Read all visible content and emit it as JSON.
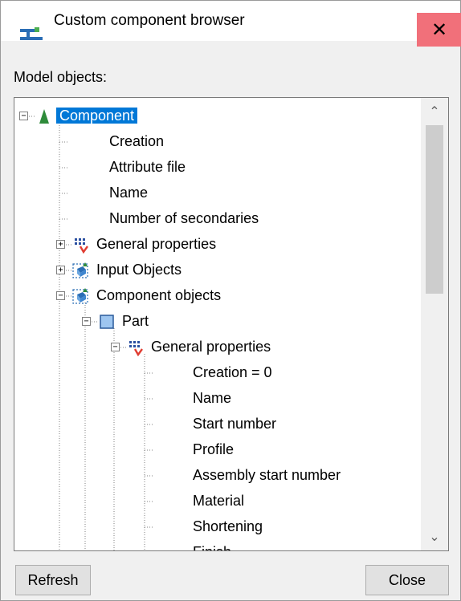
{
  "window": {
    "title": "Custom component browser",
    "close_glyph": "✕",
    "icon": "tekla-app-icon"
  },
  "section_label": "Model objects:",
  "tree": [
    {
      "label": "Component",
      "level": 0,
      "toggle": "−",
      "icon": "cone-icon",
      "selected": true
    },
    {
      "label": "Creation",
      "level": 1
    },
    {
      "label": "Attribute file",
      "level": 1
    },
    {
      "label": "Name",
      "level": 1
    },
    {
      "label": "Number of secondaries",
      "level": 1
    },
    {
      "label": "General properties",
      "level": 1,
      "toggle": "+",
      "icon": "properties-icon"
    },
    {
      "label": "Input Objects",
      "level": 1,
      "toggle": "+",
      "icon": "objects-icon"
    },
    {
      "label": "Component objects",
      "level": 1,
      "toggle": "−",
      "icon": "objects-icon"
    },
    {
      "label": "Part",
      "level": 2,
      "toggle": "−",
      "icon": "part-icon"
    },
    {
      "label": "General properties",
      "level": 3,
      "toggle": "−",
      "icon": "properties-icon"
    },
    {
      "label": "Creation = 0",
      "level": 4
    },
    {
      "label": "Name",
      "level": 4
    },
    {
      "label": "Start number",
      "level": 4
    },
    {
      "label": "Profile",
      "level": 4
    },
    {
      "label": "Assembly start number",
      "level": 4
    },
    {
      "label": "Material",
      "level": 4
    },
    {
      "label": "Shortening",
      "level": 4
    },
    {
      "label": "Finish",
      "level": 4
    }
  ],
  "scrollbar": {
    "up_glyph": "⌃",
    "down_glyph": "⌄"
  },
  "buttons": {
    "refresh": "Refresh",
    "close": "Close"
  },
  "colors": {
    "selection": "#0078d7",
    "close_hover": "#f1707a"
  }
}
